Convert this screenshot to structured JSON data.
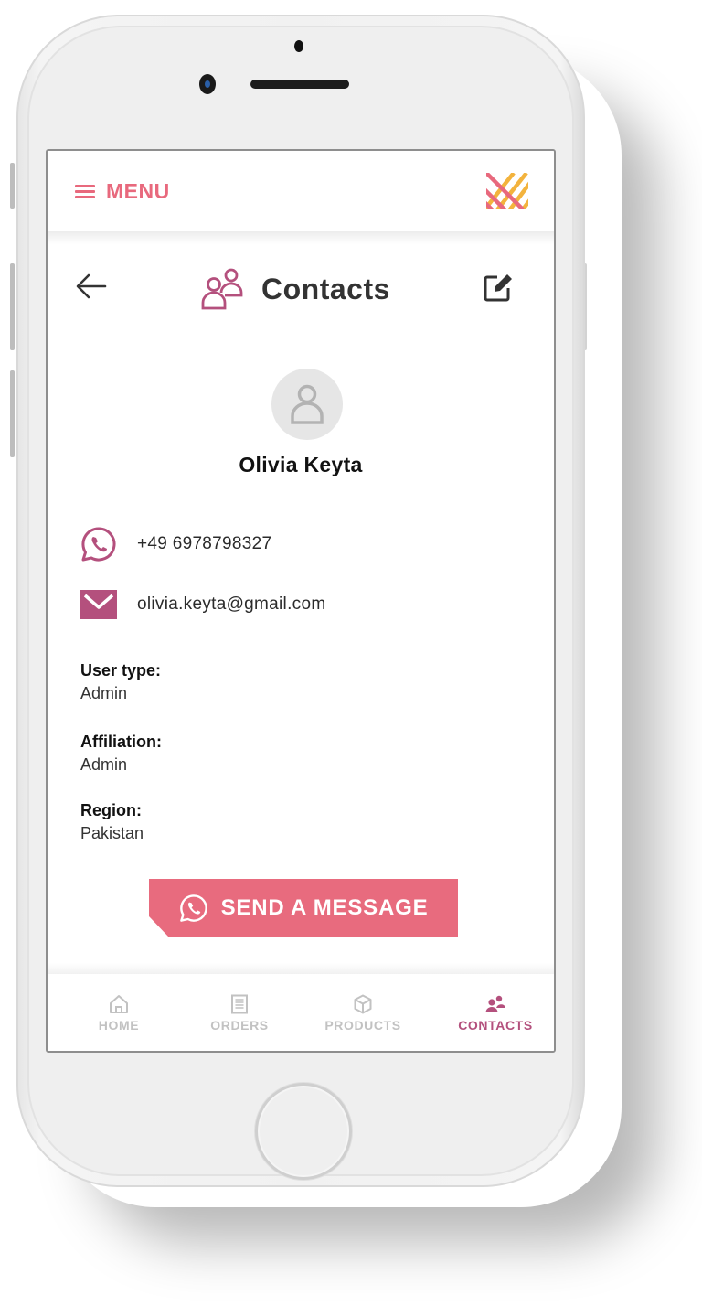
{
  "colors": {
    "accent_pink": "#e86b7e",
    "accent_plum": "#b4507d",
    "logo_yellow": "#f3b33d",
    "text_dark": "#333333",
    "nav_inactive": "#c2c2c2"
  },
  "topbar": {
    "menu_label": "MENU",
    "menu_icon": "hamburger-icon",
    "logo_icon": "brand-logo"
  },
  "header": {
    "back_icon": "arrow-left-icon",
    "title": "Contacts",
    "title_icon": "users-icon",
    "edit_icon": "edit-icon"
  },
  "contact": {
    "avatar_icon": "user-placeholder-icon",
    "name": "Olivia Keyta",
    "phone": "+49 6978798327",
    "phone_icon": "whatsapp-icon",
    "email": "olivia.keyta@gmail.com",
    "email_icon": "envelope-icon",
    "fields": [
      {
        "label": "User type:",
        "value": "Admin"
      },
      {
        "label": "Affiliation:",
        "value": "Admin"
      },
      {
        "label": "Region:",
        "value": "Pakistan"
      }
    ]
  },
  "actions": {
    "send_message_label": "SEND A MESSAGE",
    "send_message_icon": "whatsapp-icon"
  },
  "bottom_nav": {
    "items": [
      {
        "label": "HOME",
        "icon": "home-icon",
        "active": false
      },
      {
        "label": "ORDERS",
        "icon": "document-icon",
        "active": false
      },
      {
        "label": "PRODUCTS",
        "icon": "box-icon",
        "active": false
      },
      {
        "label": "CONTACTS",
        "icon": "users-filled-icon",
        "active": true
      }
    ]
  }
}
